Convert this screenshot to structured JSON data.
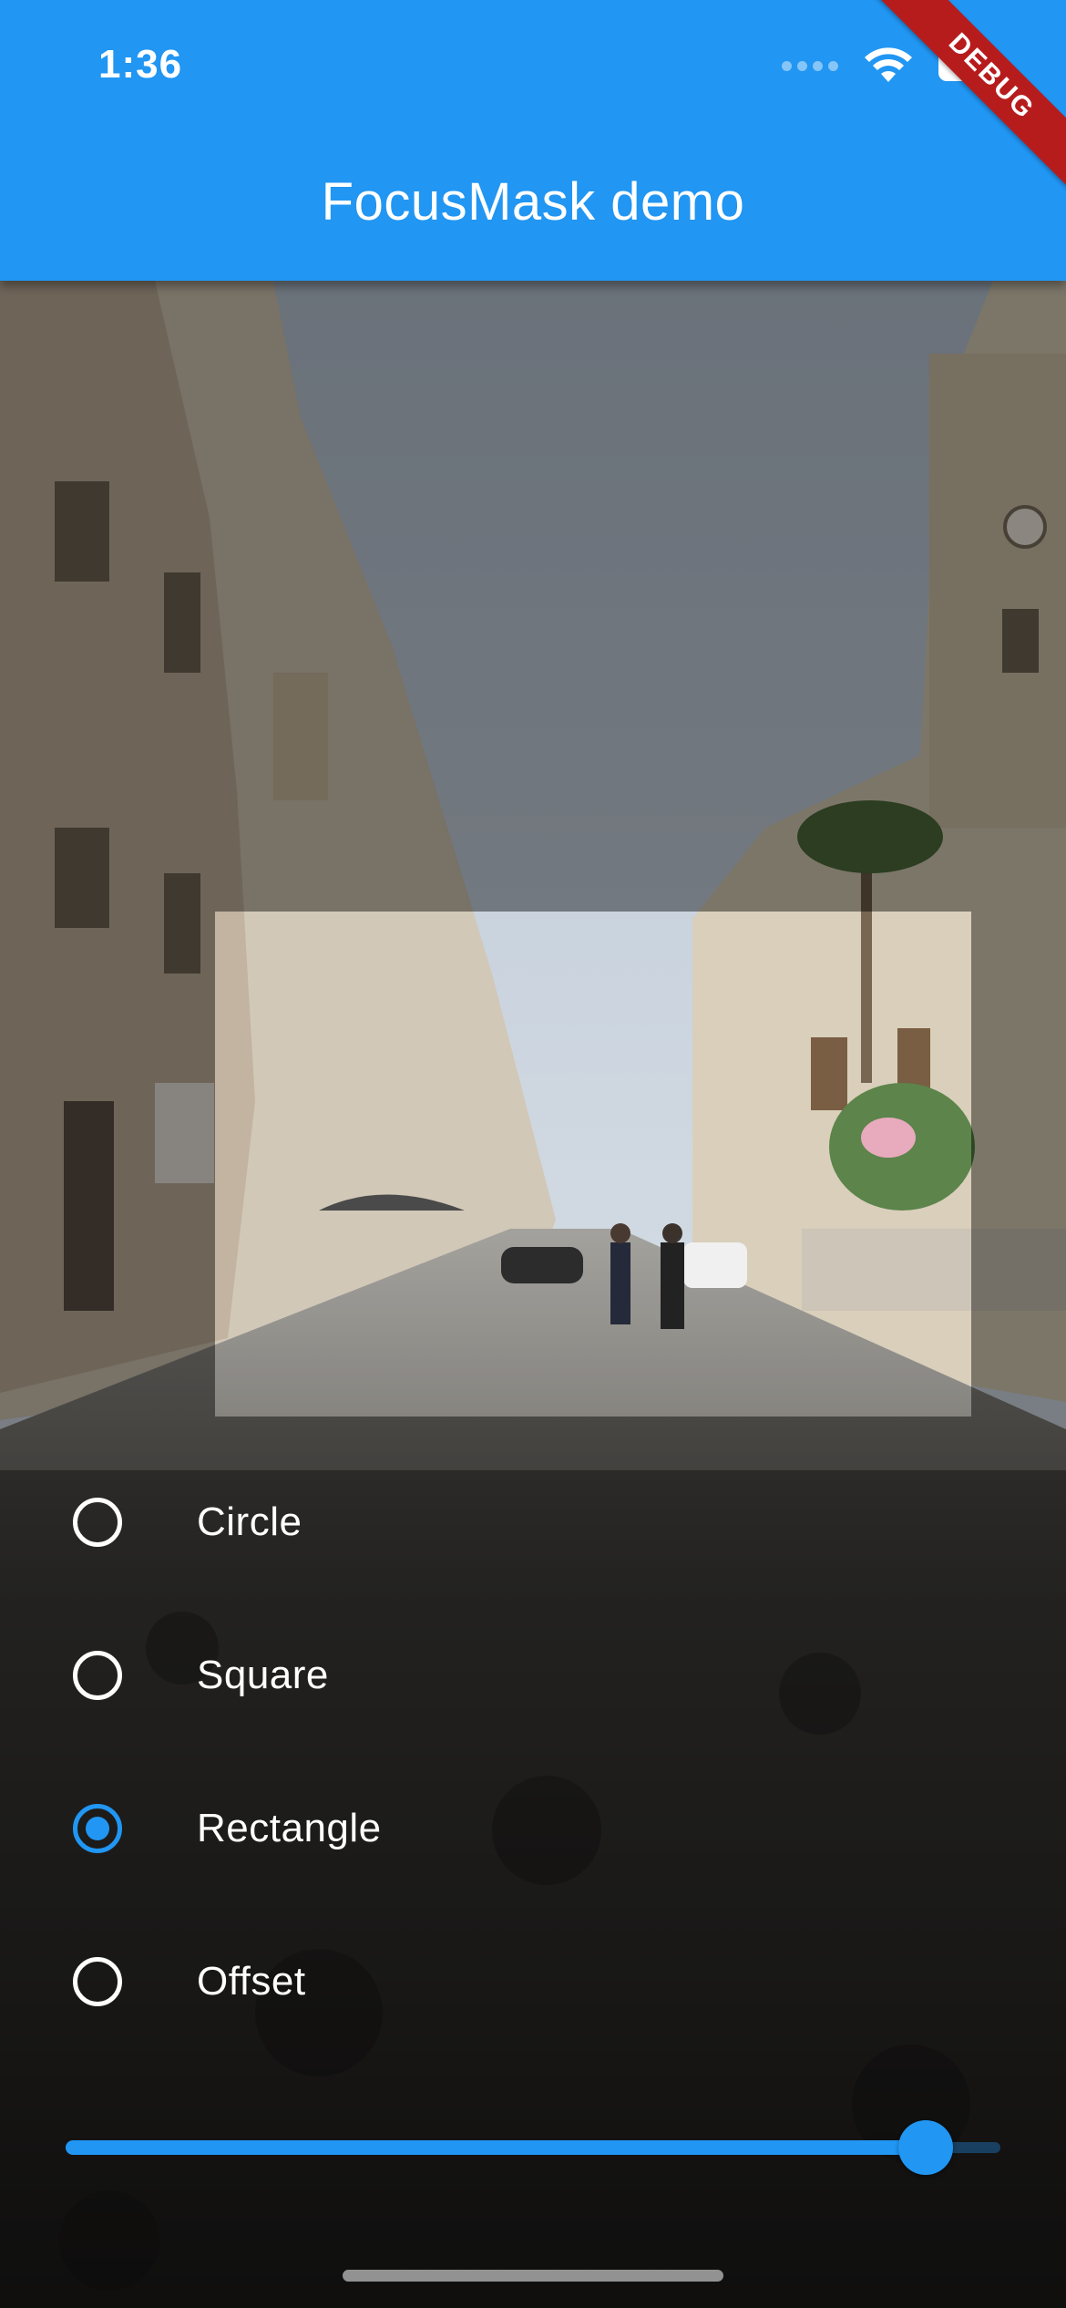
{
  "status_bar": {
    "time": "1:36"
  },
  "app_bar": {
    "title": "FocusMask demo",
    "debug_banner": "DEBUG",
    "color": "#2196F3"
  },
  "options": [
    {
      "label": "Circle",
      "selected": false
    },
    {
      "label": "Square",
      "selected": false
    },
    {
      "label": "Rectangle",
      "selected": true
    },
    {
      "label": "Offset",
      "selected": false
    }
  ],
  "slider": {
    "value_fraction": 0.92
  },
  "icons": [
    "wifi-icon",
    "battery-icon",
    "cellular-signal-icon"
  ],
  "colors": {
    "accent": "#2196F3",
    "banner": "#B71C1C"
  }
}
